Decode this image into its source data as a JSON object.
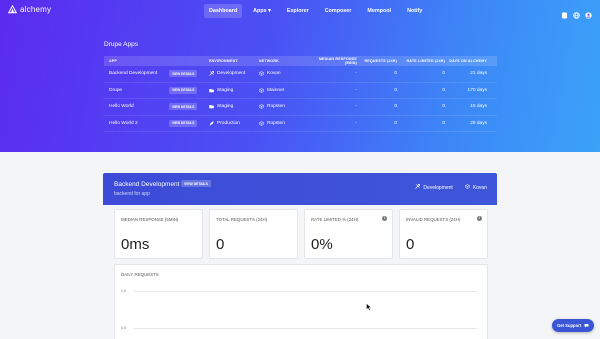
{
  "header": {
    "brand": "alchemy",
    "nav": [
      {
        "label": "Dashboard",
        "active": true
      },
      {
        "label": "Apps ▾",
        "active": false
      },
      {
        "label": "Explorer",
        "active": false
      },
      {
        "label": "Composer",
        "active": false
      },
      {
        "label": "Mempool",
        "active": false
      },
      {
        "label": "Notify",
        "active": false
      }
    ],
    "icons": [
      "database-icon",
      "globe-icon",
      "user-icon"
    ]
  },
  "apps_section": {
    "title": "Drupe Apps",
    "columns": [
      "APP",
      "ENVIRONMENT",
      "NETWORK",
      "MEDIAN RESPONSE (5MIN)",
      "REQUESTS (24H)",
      "RATE LIMITED (24H)",
      "DAYS ON ALCHEMY"
    ],
    "view_details_label": "VIEW DETAILS",
    "rows": [
      {
        "app": "Backend Development",
        "environment": "Development",
        "env_icon": "tools-icon",
        "network": "Kovan",
        "median": "-",
        "requests": "0",
        "rate_limited": "0",
        "days": "21 days"
      },
      {
        "app": "Drupe",
        "environment": "Staging",
        "env_icon": "folder-icon",
        "network": "Mainnet",
        "median": "-",
        "requests": "0",
        "rate_limited": "0",
        "days": "170 days"
      },
      {
        "app": "Hello World",
        "environment": "Staging",
        "env_icon": "folder-icon",
        "network": "Ropsten",
        "median": "-",
        "requests": "0",
        "rate_limited": "0",
        "days": "15 days"
      },
      {
        "app": "Hello World 2",
        "environment": "Production",
        "env_icon": "rocket-icon",
        "network": "Ropsten",
        "median": "-",
        "requests": "0",
        "rate_limited": "0",
        "days": "29 days"
      }
    ]
  },
  "detail_panel": {
    "title": "Backend Development",
    "view_details_label": "VIEW DETAILS",
    "subtitle": "backend for app",
    "environment": "Development",
    "network": "Kovan",
    "stats": [
      {
        "label": "MEDIAN RESPONSE (5MIN)",
        "value": "0ms",
        "info": false
      },
      {
        "label": "TOTAL REQUESTS (24H)",
        "value": "0",
        "info": false
      },
      {
        "label": "RATE LIMITED % (24H)",
        "value": "0%",
        "info": true
      },
      {
        "label": "INVALID REQUESTS (24H)",
        "value": "0",
        "info": true
      }
    ],
    "daily_requests": {
      "label": "DAILY REQUESTS",
      "y_ticks": [
        "1.0",
        "0.5"
      ]
    }
  },
  "support": {
    "label": "Get Support"
  },
  "colors": {
    "accent": "#3a55d6",
    "hero_start": "#5b2bf0",
    "hero_end": "#3ba2f8"
  }
}
